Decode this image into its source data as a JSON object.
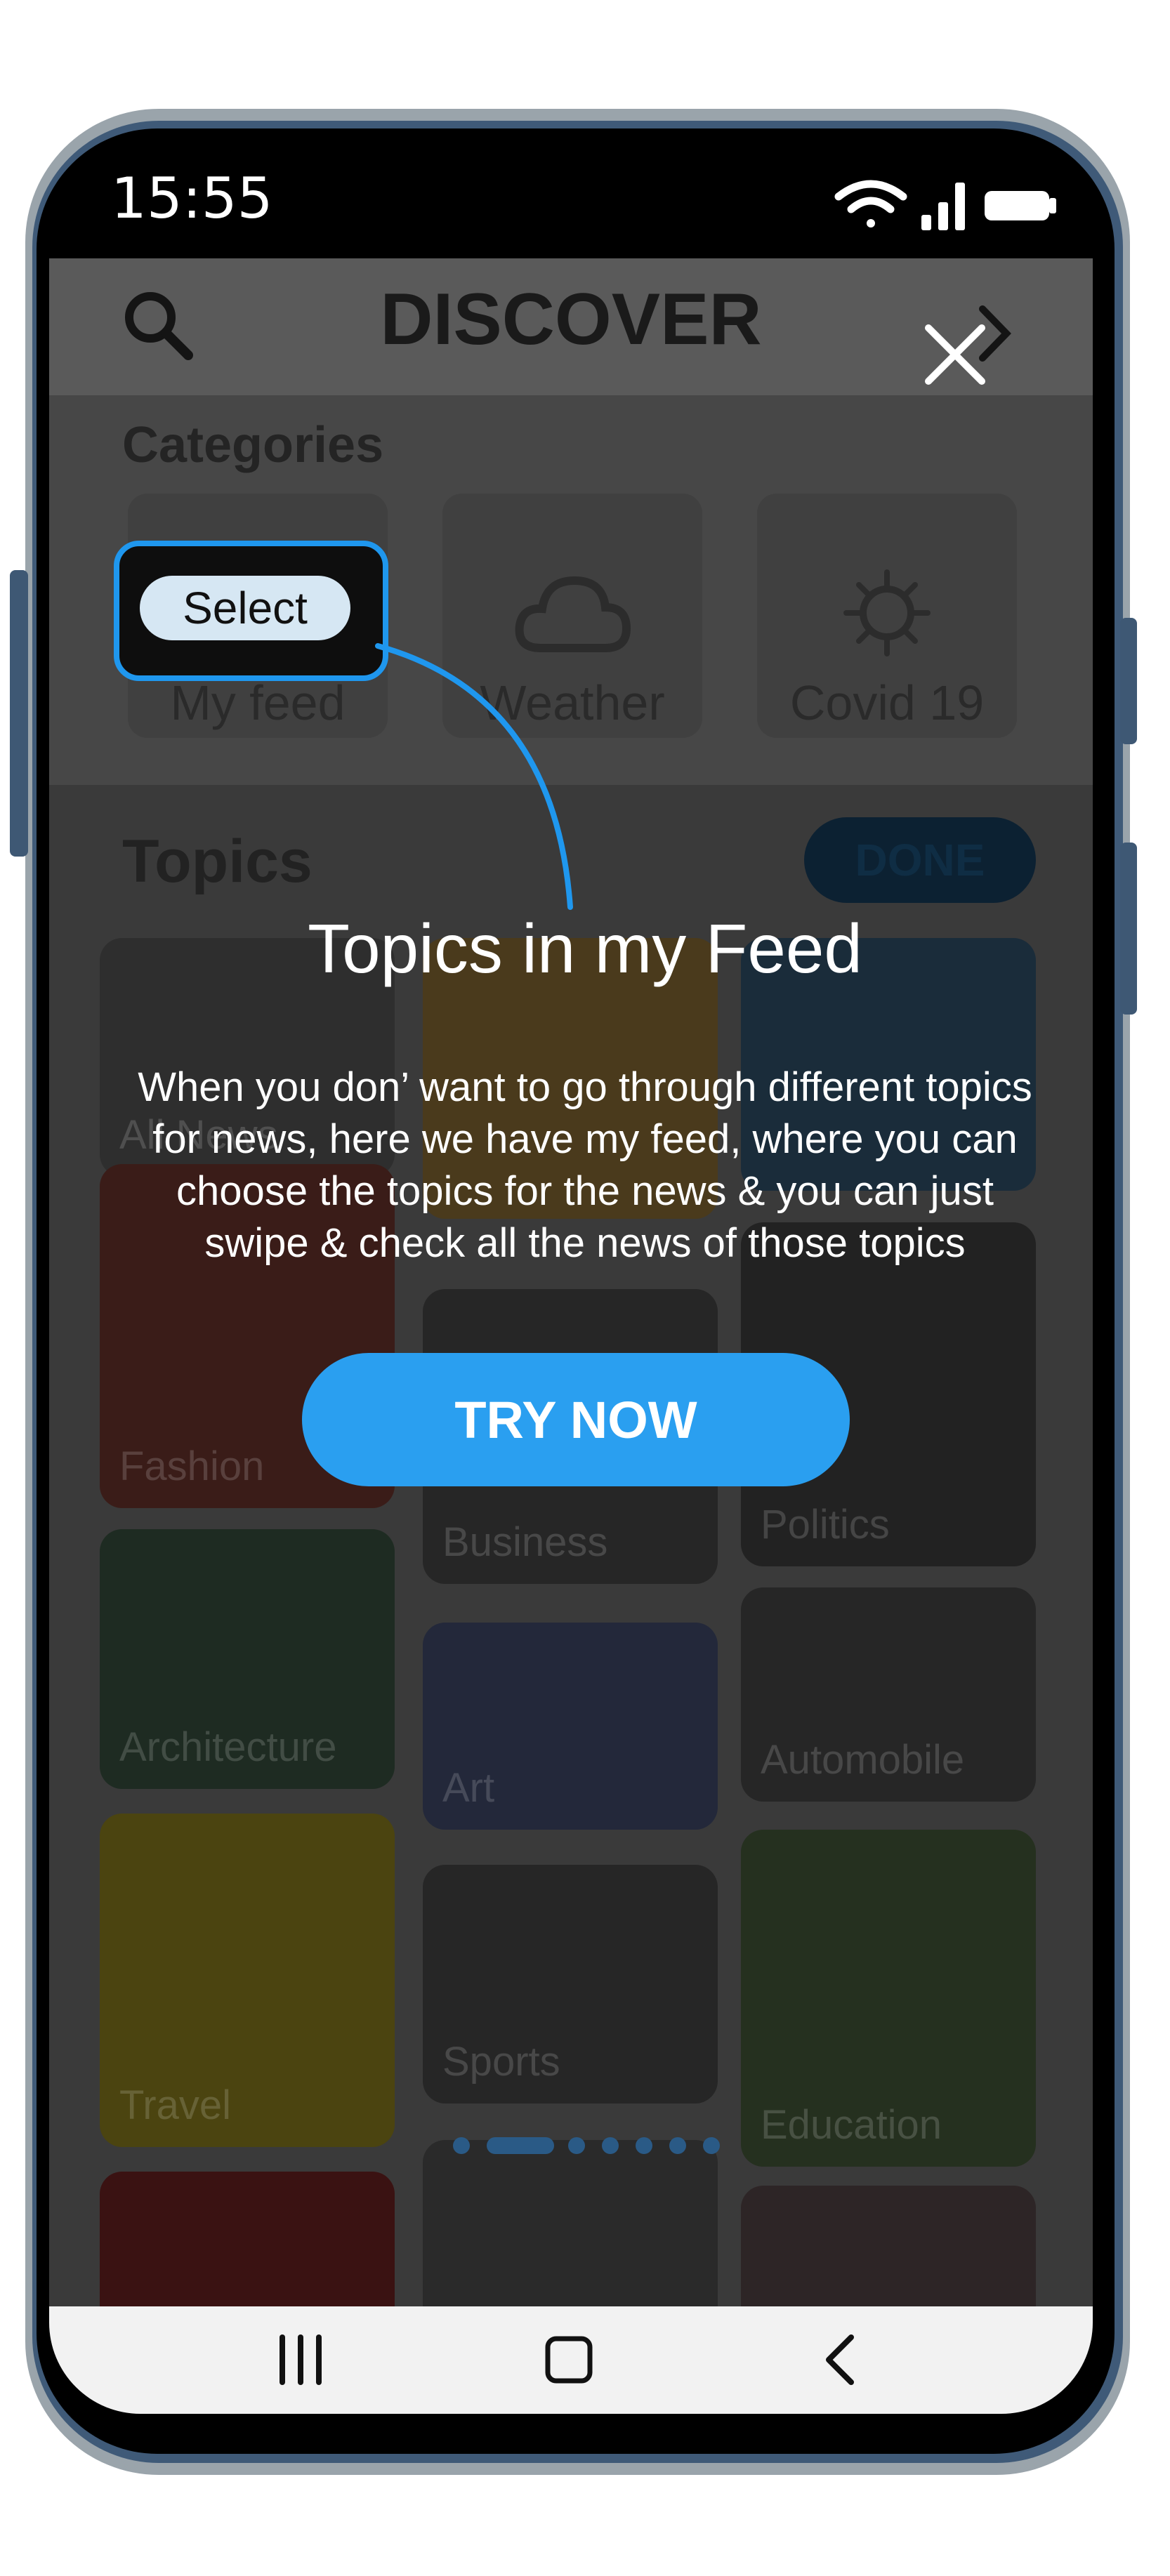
{
  "status_bar": {
    "time": "15:55",
    "icons": [
      "wifi-icon",
      "signal-icon",
      "battery-icon"
    ]
  },
  "header": {
    "title": "DISCOVER",
    "search_icon": "search-icon",
    "chevron_icon": "chevron-right-icon"
  },
  "categories": {
    "title": "Categories",
    "items": [
      {
        "label": "My feed",
        "icon": "feed-icon"
      },
      {
        "label": "Weather",
        "icon": "cloud-icon"
      },
      {
        "label": "Covid 19",
        "icon": "virus-icon"
      }
    ]
  },
  "topics": {
    "title": "Topics",
    "done_label": "DONE",
    "tiles": [
      {
        "label": "All News"
      },
      {
        "label": ""
      },
      {
        "label": ""
      },
      {
        "label": "Fashion"
      },
      {
        "label": "Business"
      },
      {
        "label": "Politics"
      },
      {
        "label": "Architecture"
      },
      {
        "label": "Art"
      },
      {
        "label": "Automobile"
      },
      {
        "label": "Travel"
      },
      {
        "label": "Sports"
      },
      {
        "label": "Education"
      },
      {
        "label": ""
      },
      {
        "label": ""
      },
      {
        "label": ""
      }
    ]
  },
  "coach_mark": {
    "highlight_label": "Select",
    "title": "Topics in my Feed",
    "description": "When you don’ want to go through different topics for news, here we have my feed, where you can choose the topics for the news & you can just swipe & check all the news of those topics",
    "cta_label": "TRY NOW",
    "close_icon": "close-icon",
    "page_indicator": {
      "total": 7,
      "active": 1
    }
  },
  "nav_bar": {
    "icons": [
      "recent-apps-icon",
      "home-icon",
      "back-icon"
    ]
  },
  "colors": {
    "accent": "#2a9ff0",
    "highlight_border": "#1f97ee",
    "select_chip": "#d6e7f3",
    "nav_background": "#f2f2f2",
    "phone_frame": "#3f5a78"
  }
}
